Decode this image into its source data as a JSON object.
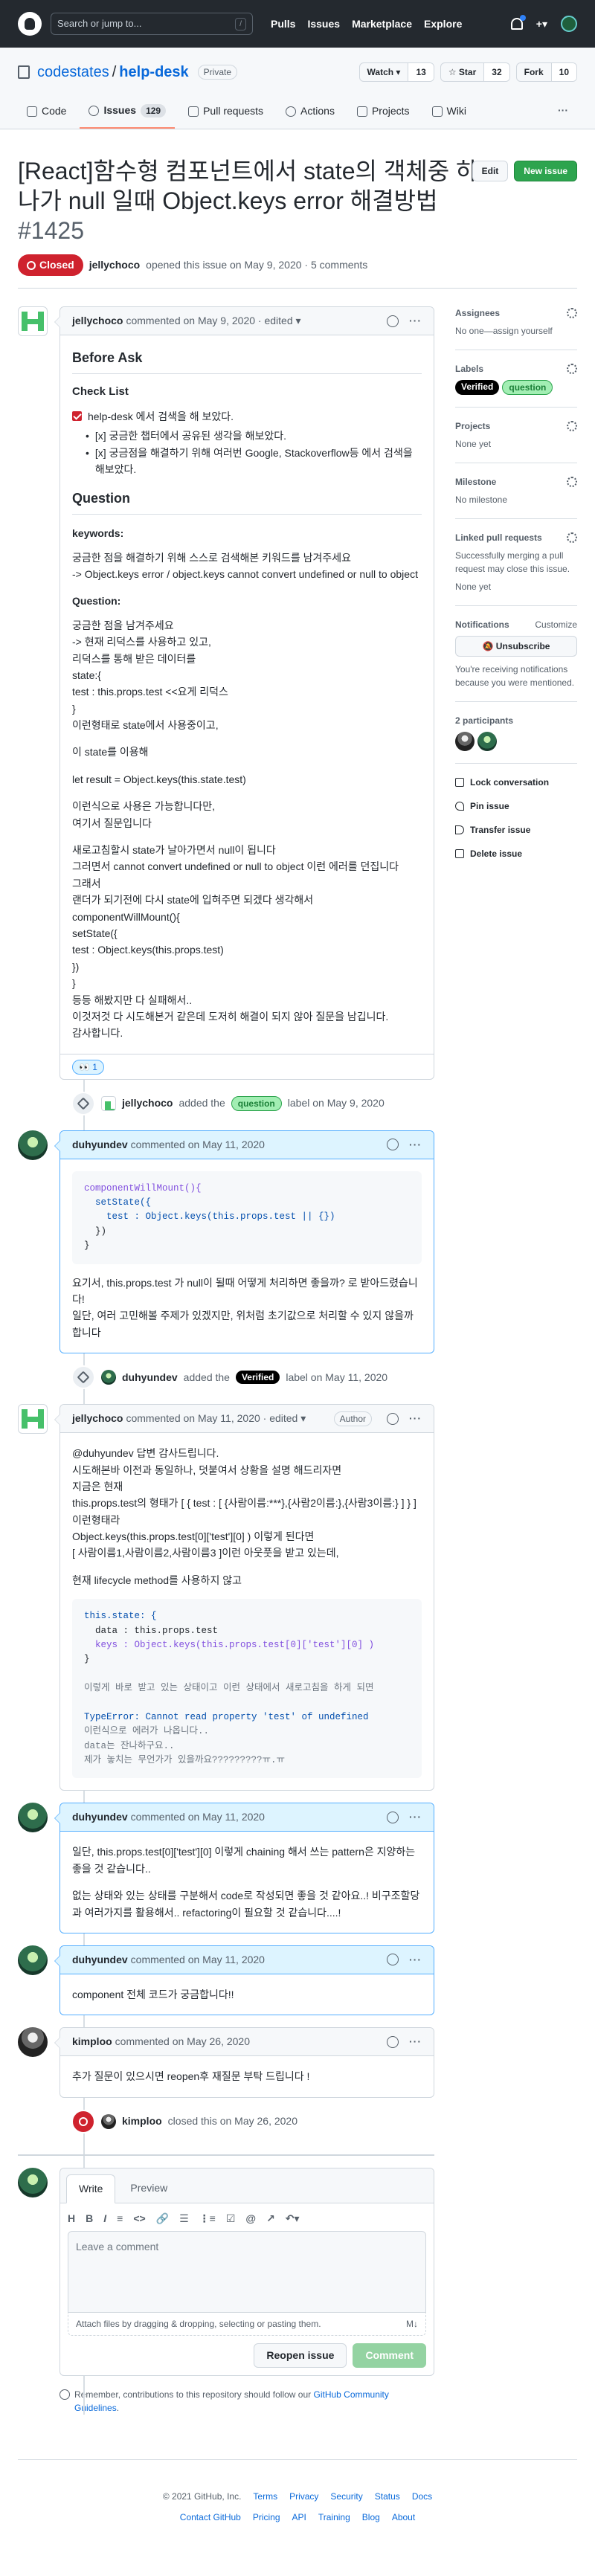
{
  "header": {
    "search_placeholder": "Search or jump to...",
    "search_key": "/",
    "nav": [
      "Pulls",
      "Issues",
      "Marketplace",
      "Explore"
    ],
    "plus": "+▾"
  },
  "repo": {
    "owner": "codestates",
    "separator": "/",
    "name": "help-desk",
    "visibility": "Private",
    "watch_label": "Watch ▾",
    "watch_count": "13",
    "star_label": "☆ Star",
    "star_count": "32",
    "fork_label": "Fork",
    "fork_count": "10"
  },
  "tabs": [
    {
      "label": "Code"
    },
    {
      "label": "Issues",
      "count": "129"
    },
    {
      "label": "Pull requests"
    },
    {
      "label": "Actions"
    },
    {
      "label": "Projects"
    },
    {
      "label": "Wiki"
    }
  ],
  "tabs_more": "···",
  "issue": {
    "title": "[React]함수형 컴포넌트에서 state의 객체중 하나가 null 일때 Object.keys error 해결방법",
    "number": "#1425",
    "edit_label": "Edit",
    "new_issue_label": "New issue",
    "state": "Closed",
    "author": "jellychoco",
    "opened_text": "opened this issue on May 9, 2020 · 5 comments"
  },
  "comments": [
    {
      "author": "jellychoco",
      "meta": "commented on May 9, 2020 · edited ▾",
      "before_ask": "Before Ask",
      "checklist_title": "Check List",
      "task1": "help-desk 에서 검색을 해 보았다.",
      "task2": "[x] 궁금한 챕터에서 공유된 생각을 해보았다.",
      "task3": "[x] 궁금점을 해결하기 위해 여러번 Google, Stackoverflow등 에서 검색을 해보았다.",
      "question_title": "Question",
      "keywords_title": "keywords:",
      "keywords_1": "궁금한 점을 해결하기 위해 스스로 검색해본 키워드를 남겨주세요",
      "keywords_2": "-> Object.keys error / object.keys cannot convert undefined or null to object",
      "question_sub": "Question:",
      "q_lines": [
        "궁금한 점을 남겨주세요",
        "-> 현재 리덕스를 사용하고 있고,",
        "리덕스를 통해 받은 데이터를",
        "state:{",
        "test : this.props.test <<요게 리덕스",
        "}",
        "이런형태로 state에서 사용중이고,"
      ],
      "p2": "이 state를 이용해",
      "p3": "let result = Object.keys(this.state.test)",
      "p4_lines": [
        "이런식으로 사용은 가능합니다만,",
        "여기서 질문입니다"
      ],
      "p5_lines": [
        "새로고침할시 state가 날아가면서 null이 됩니다",
        "그러면서 cannot convert undefined or null to object 이런 에러를 던집니다",
        "그래서",
        "랜더가 되기전에 다시 state에 입혀주면 되겠다 생각해서",
        "componentWillMount(){",
        "setState({",
        "test : Object.keys(this.props.test)",
        "})",
        "}",
        "등등 해봤지만 다 실패해서..",
        "이것저것 다 시도해본거 같은데 도저히 해결이 되지 않아 질문을 남깁니다.",
        "감사합니다."
      ],
      "reaction": "👀 1"
    },
    {
      "author": "duhyundev",
      "meta": "commented on May 11, 2020",
      "code": [
        "componentWillMount(){",
        "  setState({",
        "    test : Object.keys(this.props.test || {})",
        "  })",
        "}"
      ],
      "text_lines": [
        "요기서, this.props.test 가 null이 될때 어떻게 처리하면 좋을까? 로 받아드렸습니다!",
        "일단, 여러 고민해볼 주제가 있겠지만, 위처럼 초기값으로 처리할 수 있지 않을까합니다"
      ]
    },
    {
      "author": "jellychoco",
      "meta": "commented on May 11, 2020 · edited ▾",
      "author_badge": "Author",
      "lines": [
        "@duhyundev 답변 감사드립니다.",
        "시도해본바 이전과 동일하나, 덧붙여서 상황을 설명 해드리자면",
        "지금은 현재",
        "this.props.test의 형태가 [ { test : [ {사람이름:***},{사람2이름:},{사람3이름:} ] } ]",
        "이런형태라",
        "Object.keys(this.props.test[0]['test'][0] ) 이렇게 된다면",
        "[ 사람이름1,사람이름2,사람이름3 ]이런 아웃풋을 받고 있는데,"
      ],
      "p2": "현재 lifecycle method를 사용하지 않고",
      "code_lines": [
        "this.state: {",
        "  data : this.props.test",
        "  keys : Object.keys(this.props.test[0]['test'][0] )",
        "}"
      ],
      "code_note": "이렇게 바로 받고 있는 상태이고 이런 상태에서 새로고침을 하게 되면",
      "code_err": "TypeError: Cannot read property 'test' of undefined",
      "code_tail": [
        "이런식으로 에러가 나옵니다..",
        "data는 잔나하구요..",
        "제가 놓치는 무언가가 있을까요?????????ㅠ.ㅠ"
      ]
    },
    {
      "author": "duhyundev",
      "meta": "commented on May 11, 2020",
      "p1": "일단, this.props.test[0]['test'][0] 이렇게 chaining 해서 쓰는 pattern은 지양하는 좋을 것 같습니다..",
      "p2": "없는 상태와 있는 상태를 구분해서 code로 작성되면 좋을 것 같아요..! 비구조할당과 여러가지를 활용해서.. refactoring이 필요할 것 같습니다....!"
    },
    {
      "author": "duhyundev",
      "meta": "commented on May 11, 2020",
      "p1": "component 전체 코드가 궁금합니다!!"
    },
    {
      "author": "kimploo",
      "meta": "commented on May 26, 2020",
      "p1": "추가 질문이 있으시면 reopen후 재질문 부탁 드립니다 !"
    }
  ],
  "events": [
    {
      "actor": "jellychoco",
      "action": "added the",
      "label": "question",
      "suffix": "label on May 9, 2020"
    },
    {
      "actor": "duhyundev",
      "action": "added the",
      "label": "Verified",
      "suffix": "label on May 11, 2020"
    },
    {
      "actor": "kimploo",
      "action": "closed this on May 26, 2020"
    }
  ],
  "sidebar": {
    "assignees_title": "Assignees",
    "assignees_text": "No one—assign yourself",
    "labels_title": "Labels",
    "labels": [
      "Verified",
      "question"
    ],
    "projects_title": "Projects",
    "projects_text": "None yet",
    "milestone_title": "Milestone",
    "milestone_text": "No milestone",
    "linked_title": "Linked pull requests",
    "linked_text": "Successfully merging a pull request may close this issue.",
    "linked_none": "None yet",
    "notifications_title": "Notifications",
    "customize": "Customize",
    "unsubscribe": "Unsubscribe",
    "notif_text": "You're receiving notifications because you were mentioned.",
    "participants_title": "2 participants",
    "actions": [
      "Lock conversation",
      "Pin issue",
      "Transfer issue",
      "Delete issue"
    ]
  },
  "composer": {
    "tab_write": "Write",
    "tab_preview": "Preview",
    "toolbar": [
      "H",
      "B",
      "I",
      "≡",
      "<>",
      "🔗",
      "☰",
      "⋮≡",
      "☑",
      "@",
      "↗",
      "↶▾"
    ],
    "placeholder": "Leave a comment",
    "attach": "Attach files by dragging & dropping, selecting or pasting them.",
    "md_badge": "M↓",
    "reopen": "Reopen issue",
    "submit": "Comment",
    "guide_prefix": "Remember, contributions to this repository should follow our",
    "guide_link": "GitHub Community Guidelines",
    "guide_suffix": "."
  },
  "footer": {
    "copyright": "© 2021 GitHub, Inc.",
    "row1": [
      "Terms",
      "Privacy",
      "Security",
      "Status",
      "Docs"
    ],
    "row2": [
      "Contact GitHub",
      "Pricing",
      "API",
      "Training",
      "Blog",
      "About"
    ]
  }
}
